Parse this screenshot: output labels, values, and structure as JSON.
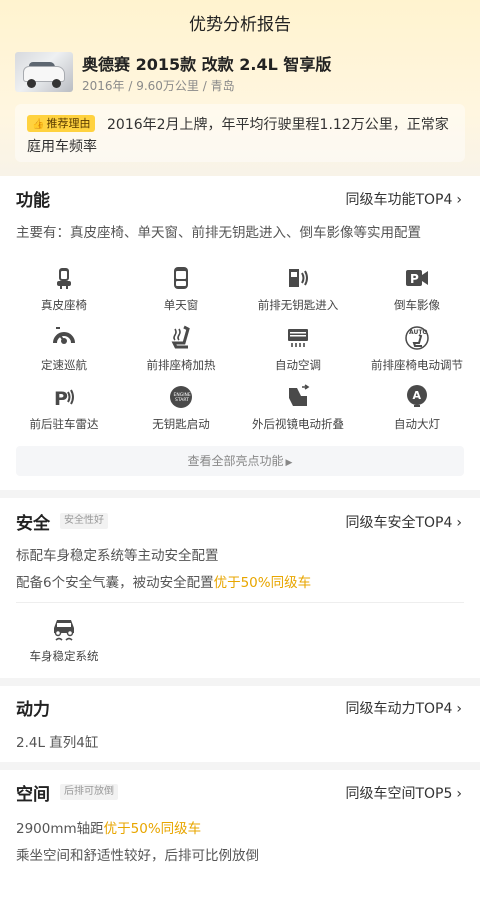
{
  "header": {
    "title": "优势分析报告"
  },
  "car": {
    "name": "奥德赛 2015款 改款 2.4L 智享版",
    "meta": "2016年 / 9.60万公里 / 青岛"
  },
  "reason": {
    "tag": "推荐理由",
    "text": "2016年2月上牌，年平均行驶里程1.12万公里，正常家庭用车频率"
  },
  "function": {
    "title": "功能",
    "rank": "同级车功能TOP4",
    "summary": "主要有：真皮座椅、单天窗、前排无钥匙进入、倒车影像等实用配置",
    "features": [
      {
        "label": "真皮座椅",
        "icon": "leather-seat-icon"
      },
      {
        "label": "单天窗",
        "icon": "sunroof-icon"
      },
      {
        "label": "前排无钥匙进入",
        "icon": "keyless-entry-icon"
      },
      {
        "label": "倒车影像",
        "icon": "reverse-camera-icon"
      },
      {
        "label": "定速巡航",
        "icon": "cruise-control-icon"
      },
      {
        "label": "前排座椅加热",
        "icon": "seat-heating-icon"
      },
      {
        "label": "自动空调",
        "icon": "auto-ac-icon"
      },
      {
        "label": "前排座椅电动调节",
        "icon": "power-seat-icon"
      },
      {
        "label": "前后驻车雷达",
        "icon": "parking-radar-icon"
      },
      {
        "label": "无钥匙启动",
        "icon": "keyless-start-icon"
      },
      {
        "label": "外后视镜电动折叠",
        "icon": "mirror-fold-icon"
      },
      {
        "label": "自动大灯",
        "icon": "auto-headlight-icon"
      }
    ],
    "more": "查看全部亮点功能"
  },
  "safety": {
    "title": "安全",
    "badge": "安全性好",
    "rank": "同级车安全TOP4",
    "line1": "标配车身稳定系统等主动安全配置",
    "line2_prefix": "配备6个安全气囊，被动安全配置",
    "line2_highlight": "优于50%同级车",
    "feature": {
      "label": "车身稳定系统",
      "icon": "esp-icon"
    }
  },
  "power": {
    "title": "动力",
    "rank": "同级车动力TOP4",
    "text": "2.4L 直列4缸"
  },
  "space": {
    "title": "空间",
    "badge": "后排可放倒",
    "rank": "同级车空间TOP5",
    "line1_prefix": "2900mm轴距",
    "line1_highlight": "优于50%同级车",
    "line2": "乘坐空间和舒适性较好，后排可比例放倒"
  },
  "colors": {
    "accent": "#ffd23f",
    "highlight": "#e8a600"
  }
}
